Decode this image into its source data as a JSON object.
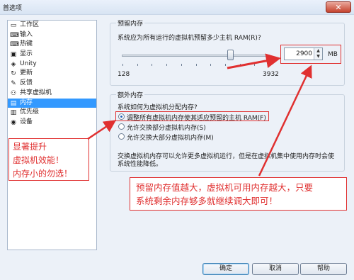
{
  "window": {
    "title": "首选项",
    "close_glyph": "✕"
  },
  "sidebar": {
    "items": [
      {
        "label": "工作区",
        "icon": "workspace-icon",
        "glyph": "▭"
      },
      {
        "label": "输入",
        "icon": "input-icon",
        "glyph": "⌨"
      },
      {
        "label": "热键",
        "icon": "hotkey-icon",
        "glyph": "⌨"
      },
      {
        "label": "显示",
        "icon": "display-icon",
        "glyph": "▣"
      },
      {
        "label": "Unity",
        "icon": "unity-icon",
        "glyph": "◈"
      },
      {
        "label": "更新",
        "icon": "update-icon",
        "glyph": "↻"
      },
      {
        "label": "反馈",
        "icon": "feedback-icon",
        "glyph": "✎"
      },
      {
        "label": "共享虚拟机",
        "icon": "shared-vm-icon",
        "glyph": "⚇"
      },
      {
        "label": "内存",
        "icon": "memory-icon",
        "glyph": "▤",
        "selected": true
      },
      {
        "label": "优先级",
        "icon": "priority-icon",
        "glyph": "▥"
      },
      {
        "label": "设备",
        "icon": "device-icon",
        "glyph": "◉"
      }
    ]
  },
  "reserved_memory": {
    "legend": "预留内存",
    "question": "系统应为所有运行的虚拟机预留多少主机 RAM(R)?",
    "slider_min_label": "128",
    "slider_max_label": "3932",
    "slider_value_fraction": 0.73,
    "value": "2900",
    "unit": "MB"
  },
  "additional_memory": {
    "legend": "额外内存",
    "question": "系统如何为虚拟机分配内存?",
    "options": [
      {
        "label": "调整所有虚拟机内存使其适应预留的主机 RAM(F)",
        "checked": true
      },
      {
        "label": "允许交换部分虚拟机内存(S)",
        "checked": false
      },
      {
        "label": "允许交换大部分虚拟机内存(M)",
        "checked": false
      }
    ],
    "note_line1": "交换虚拟机内存可以允许更多虚拟机运行，但是在虚拟机集中使用内存时会使",
    "note_line2": "系统性能降低。"
  },
  "buttons": {
    "ok": "确定",
    "cancel": "取消",
    "help": "帮助"
  },
  "annotations": {
    "left_line1": "显著提升",
    "left_line2": "虚拟机效能！",
    "left_line3": "内存小的勿选！",
    "right_line1": "预留内存值越大，虚拟机可用内存越大，只要",
    "right_line2": "系统剩余内存够多就继续调大即可！",
    "color": "#e03030"
  }
}
